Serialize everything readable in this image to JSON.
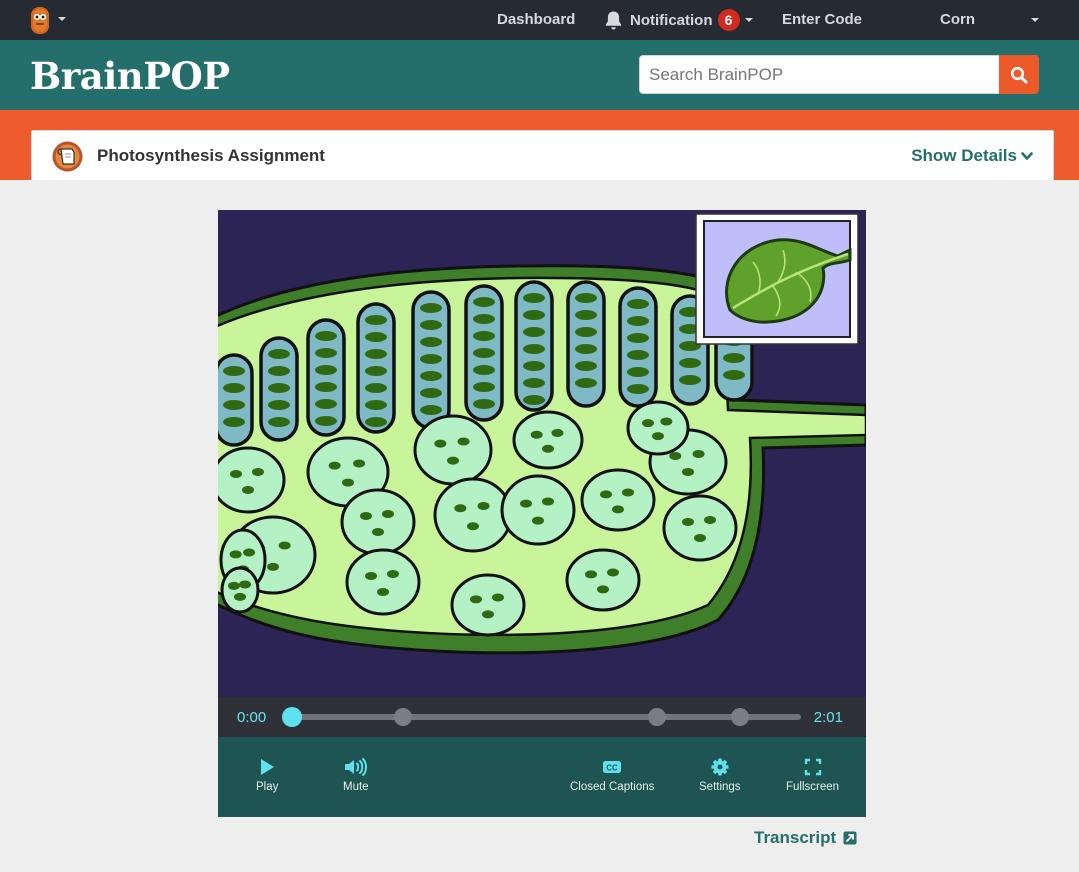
{
  "topnav": {
    "dashboard": "Dashboard",
    "notification_label": "Notification",
    "notification_count": "6",
    "enter_code": "Enter Code",
    "user_name": "Corn"
  },
  "header": {
    "logo": "BrainPOP",
    "search_placeholder": "Search BrainPOP"
  },
  "assignment": {
    "title": "Photosynthesis Assignment",
    "show_details": "Show Details"
  },
  "player": {
    "time_current": "0:00",
    "time_total": "2:01",
    "progress_fraction": 0,
    "chapter_markers_fraction": [
      0.218,
      0.718,
      0.881
    ],
    "controls": {
      "play": "Play",
      "mute": "Mute",
      "captions": "Closed Captions",
      "settings": "Settings",
      "fullscreen": "Fullscreen"
    }
  },
  "transcript_link": "Transcript",
  "colors": {
    "topnav_bg": "#252a33",
    "header_teal": "#246f6c",
    "brand_orange": "#ee5b2d",
    "notification_badge": "#d32a20",
    "player_accent": "#5fe1ee",
    "controls_bg": "#1e5552"
  },
  "icons": [
    "moby-avatar-icon",
    "bell-icon",
    "search-icon",
    "assignment-icon",
    "chevron-down-icon",
    "play-icon",
    "volume-icon",
    "closed-captions-icon",
    "gear-icon",
    "fullscreen-icon",
    "external-link-icon"
  ]
}
